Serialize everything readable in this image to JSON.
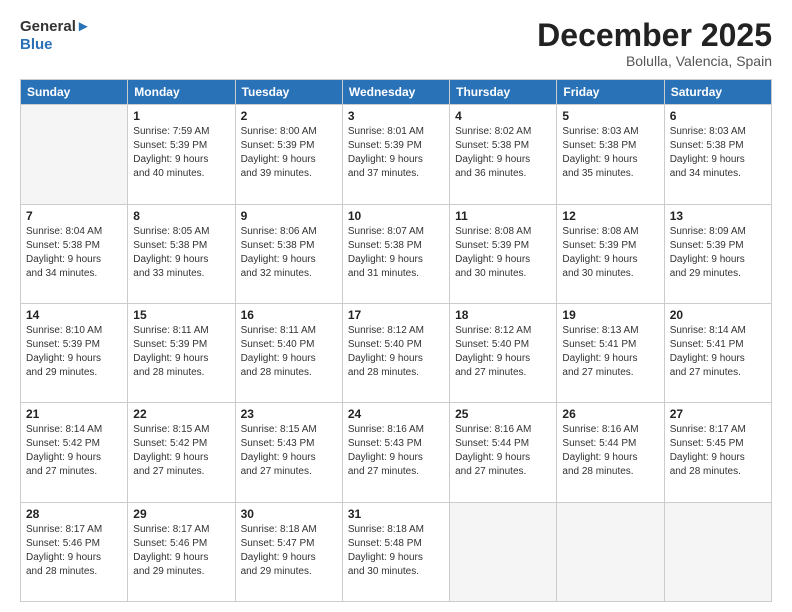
{
  "header": {
    "logo_line1": "General",
    "logo_line2": "Blue",
    "month": "December 2025",
    "location": "Bolulla, Valencia, Spain"
  },
  "weekdays": [
    "Sunday",
    "Monday",
    "Tuesday",
    "Wednesday",
    "Thursday",
    "Friday",
    "Saturday"
  ],
  "weeks": [
    [
      {
        "day": "",
        "info": ""
      },
      {
        "day": "1",
        "info": "Sunrise: 7:59 AM\nSunset: 5:39 PM\nDaylight: 9 hours\nand 40 minutes."
      },
      {
        "day": "2",
        "info": "Sunrise: 8:00 AM\nSunset: 5:39 PM\nDaylight: 9 hours\nand 39 minutes."
      },
      {
        "day": "3",
        "info": "Sunrise: 8:01 AM\nSunset: 5:39 PM\nDaylight: 9 hours\nand 37 minutes."
      },
      {
        "day": "4",
        "info": "Sunrise: 8:02 AM\nSunset: 5:38 PM\nDaylight: 9 hours\nand 36 minutes."
      },
      {
        "day": "5",
        "info": "Sunrise: 8:03 AM\nSunset: 5:38 PM\nDaylight: 9 hours\nand 35 minutes."
      },
      {
        "day": "6",
        "info": "Sunrise: 8:03 AM\nSunset: 5:38 PM\nDaylight: 9 hours\nand 34 minutes."
      }
    ],
    [
      {
        "day": "7",
        "info": "Sunrise: 8:04 AM\nSunset: 5:38 PM\nDaylight: 9 hours\nand 34 minutes."
      },
      {
        "day": "8",
        "info": "Sunrise: 8:05 AM\nSunset: 5:38 PM\nDaylight: 9 hours\nand 33 minutes."
      },
      {
        "day": "9",
        "info": "Sunrise: 8:06 AM\nSunset: 5:38 PM\nDaylight: 9 hours\nand 32 minutes."
      },
      {
        "day": "10",
        "info": "Sunrise: 8:07 AM\nSunset: 5:38 PM\nDaylight: 9 hours\nand 31 minutes."
      },
      {
        "day": "11",
        "info": "Sunrise: 8:08 AM\nSunset: 5:39 PM\nDaylight: 9 hours\nand 30 minutes."
      },
      {
        "day": "12",
        "info": "Sunrise: 8:08 AM\nSunset: 5:39 PM\nDaylight: 9 hours\nand 30 minutes."
      },
      {
        "day": "13",
        "info": "Sunrise: 8:09 AM\nSunset: 5:39 PM\nDaylight: 9 hours\nand 29 minutes."
      }
    ],
    [
      {
        "day": "14",
        "info": "Sunrise: 8:10 AM\nSunset: 5:39 PM\nDaylight: 9 hours\nand 29 minutes."
      },
      {
        "day": "15",
        "info": "Sunrise: 8:11 AM\nSunset: 5:39 PM\nDaylight: 9 hours\nand 28 minutes."
      },
      {
        "day": "16",
        "info": "Sunrise: 8:11 AM\nSunset: 5:40 PM\nDaylight: 9 hours\nand 28 minutes."
      },
      {
        "day": "17",
        "info": "Sunrise: 8:12 AM\nSunset: 5:40 PM\nDaylight: 9 hours\nand 28 minutes."
      },
      {
        "day": "18",
        "info": "Sunrise: 8:12 AM\nSunset: 5:40 PM\nDaylight: 9 hours\nand 27 minutes."
      },
      {
        "day": "19",
        "info": "Sunrise: 8:13 AM\nSunset: 5:41 PM\nDaylight: 9 hours\nand 27 minutes."
      },
      {
        "day": "20",
        "info": "Sunrise: 8:14 AM\nSunset: 5:41 PM\nDaylight: 9 hours\nand 27 minutes."
      }
    ],
    [
      {
        "day": "21",
        "info": "Sunrise: 8:14 AM\nSunset: 5:42 PM\nDaylight: 9 hours\nand 27 minutes."
      },
      {
        "day": "22",
        "info": "Sunrise: 8:15 AM\nSunset: 5:42 PM\nDaylight: 9 hours\nand 27 minutes."
      },
      {
        "day": "23",
        "info": "Sunrise: 8:15 AM\nSunset: 5:43 PM\nDaylight: 9 hours\nand 27 minutes."
      },
      {
        "day": "24",
        "info": "Sunrise: 8:16 AM\nSunset: 5:43 PM\nDaylight: 9 hours\nand 27 minutes."
      },
      {
        "day": "25",
        "info": "Sunrise: 8:16 AM\nSunset: 5:44 PM\nDaylight: 9 hours\nand 27 minutes."
      },
      {
        "day": "26",
        "info": "Sunrise: 8:16 AM\nSunset: 5:44 PM\nDaylight: 9 hours\nand 28 minutes."
      },
      {
        "day": "27",
        "info": "Sunrise: 8:17 AM\nSunset: 5:45 PM\nDaylight: 9 hours\nand 28 minutes."
      }
    ],
    [
      {
        "day": "28",
        "info": "Sunrise: 8:17 AM\nSunset: 5:46 PM\nDaylight: 9 hours\nand 28 minutes."
      },
      {
        "day": "29",
        "info": "Sunrise: 8:17 AM\nSunset: 5:46 PM\nDaylight: 9 hours\nand 29 minutes."
      },
      {
        "day": "30",
        "info": "Sunrise: 8:18 AM\nSunset: 5:47 PM\nDaylight: 9 hours\nand 29 minutes."
      },
      {
        "day": "31",
        "info": "Sunrise: 8:18 AM\nSunset: 5:48 PM\nDaylight: 9 hours\nand 30 minutes."
      },
      {
        "day": "",
        "info": ""
      },
      {
        "day": "",
        "info": ""
      },
      {
        "day": "",
        "info": ""
      }
    ]
  ]
}
